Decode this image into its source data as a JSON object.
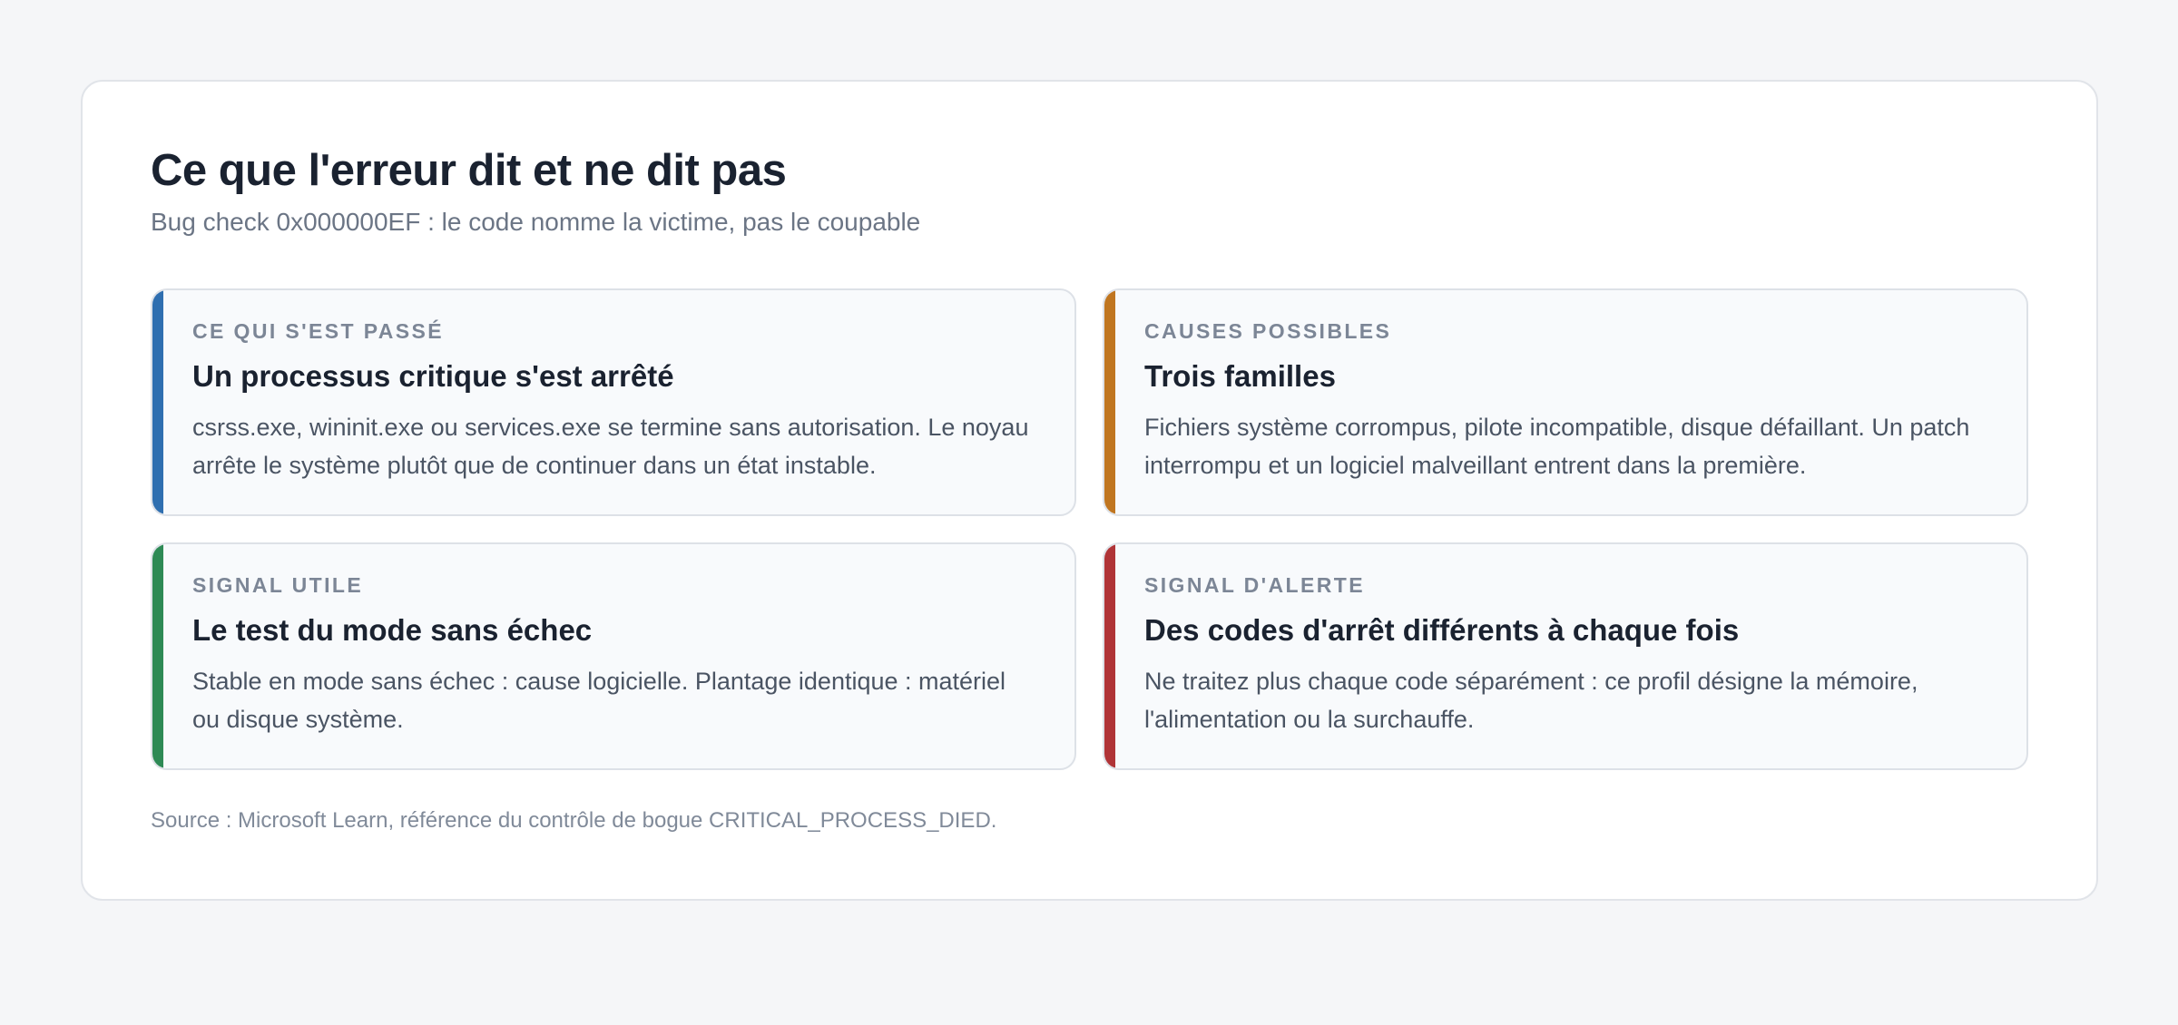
{
  "header": {
    "title": "Ce que l'erreur dit et ne dit pas",
    "subtitle": "Bug check 0x000000EF : le code nomme la victime, pas le coupable"
  },
  "panels": [
    {
      "tag": "CE QUI S'EST PASSÉ",
      "heading": "Un processus critique s'est arrêté",
      "body": "csrss.exe, wininit.exe ou services.exe se termine sans autorisation. Le noyau arrête le système plutôt que de continuer dans un état instable.",
      "accent": "#2f6fb0"
    },
    {
      "tag": "CAUSES POSSIBLES",
      "heading": "Trois familles",
      "body": "Fichiers système corrompus, pilote incompatible, disque défaillant. Un patch interrompu et un logiciel malveillant entrent dans la première.",
      "accent": "#c07620"
    },
    {
      "tag": "SIGNAL UTILE",
      "heading": "Le test du mode sans échec",
      "body": "Stable en mode sans échec : cause logicielle. Plantage identique : matériel ou disque système.",
      "accent": "#2e8a55"
    },
    {
      "tag": "SIGNAL D'ALERTE",
      "heading": "Des codes d'arrêt différents à chaque fois",
      "body": "Ne traitez plus chaque code séparément : ce profil désigne la mémoire, l'alimentation ou la surchauffe.",
      "accent": "#b03437"
    }
  ],
  "footer": {
    "source": "Source : Microsoft Learn, référence du contrôle de bogue CRITICAL_PROCESS_DIED."
  }
}
